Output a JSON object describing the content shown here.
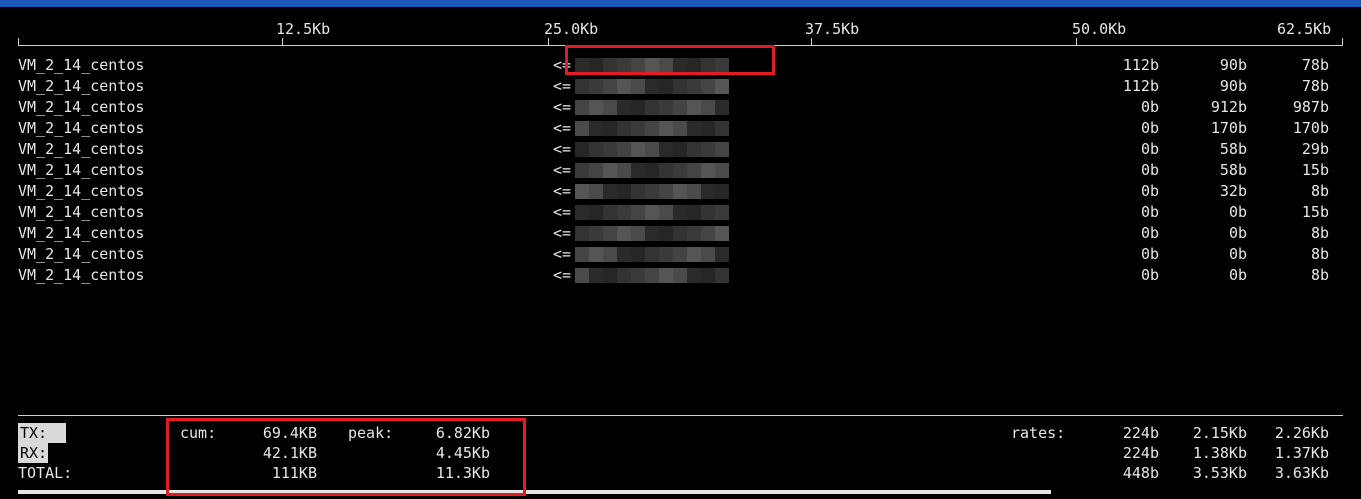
{
  "scale": {
    "labels": [
      "12.5Kb",
      "25.0Kb",
      "37.5Kb",
      "50.0Kb",
      "62.5Kb"
    ]
  },
  "rows": [
    {
      "host": "VM_2_14_centos",
      "arrow": "<=",
      "r2": "112b",
      "r10": "90b",
      "r40": "78b"
    },
    {
      "host": "VM_2_14_centos",
      "arrow": "<=",
      "r2": "112b",
      "r10": "90b",
      "r40": "78b"
    },
    {
      "host": "VM_2_14_centos",
      "arrow": "<=",
      "r2": "0b",
      "r10": "912b",
      "r40": "987b"
    },
    {
      "host": "VM_2_14_centos",
      "arrow": "<=",
      "r2": "0b",
      "r10": "170b",
      "r40": "170b"
    },
    {
      "host": "VM_2_14_centos",
      "arrow": "<=",
      "r2": "0b",
      "r10": "58b",
      "r40": "29b"
    },
    {
      "host": "VM_2_14_centos",
      "arrow": "<=",
      "r2": "0b",
      "r10": "58b",
      "r40": "15b"
    },
    {
      "host": "VM_2_14_centos",
      "arrow": "<=",
      "r2": "0b",
      "r10": "32b",
      "r40": "8b"
    },
    {
      "host": "VM_2_14_centos",
      "arrow": "<=",
      "r2": "0b",
      "r10": "0b",
      "r40": "15b"
    },
    {
      "host": "VM_2_14_centos",
      "arrow": "<=",
      "r2": "0b",
      "r10": "0b",
      "r40": "8b"
    },
    {
      "host": "VM_2_14_centos",
      "arrow": "<=",
      "r2": "0b",
      "r10": "0b",
      "r40": "8b"
    },
    {
      "host": "VM_2_14_centos",
      "arrow": "<=",
      "r2": "0b",
      "r10": "0b",
      "r40": "8b"
    }
  ],
  "summary": {
    "labels": {
      "cum": "cum:",
      "peak": "peak:",
      "rates": "rates:"
    },
    "tx": {
      "label": "TX:",
      "cum": "69.4KB",
      "peak": "6.82Kb",
      "r2": "224b",
      "r10": "2.15Kb",
      "r40": "2.26Kb"
    },
    "rx": {
      "label": "RX:",
      "cum": "42.1KB",
      "peak": "4.45Kb",
      "r2": "224b",
      "r10": "1.38Kb",
      "r40": "1.37Kb"
    },
    "total": {
      "label": "TOTAL:",
      "cum": "111KB",
      "peak": "11.3Kb",
      "r2": "448b",
      "r10": "3.53Kb",
      "r40": "3.63Kb"
    }
  },
  "colors": {
    "annotation": "#e31b23",
    "titlebar": "#1b58b6",
    "background": "#000000"
  }
}
